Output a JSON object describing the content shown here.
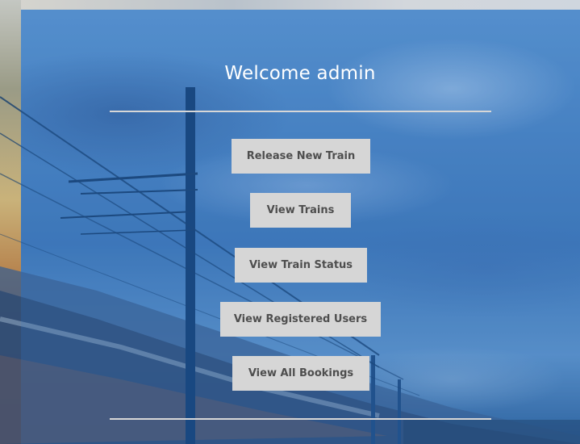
{
  "header": {
    "title": "Welcome admin"
  },
  "menu": {
    "buttons": [
      {
        "label": "Release New Train"
      },
      {
        "label": "View Trains"
      },
      {
        "label": "View Train Status"
      },
      {
        "label": "View Registered Users"
      },
      {
        "label": "View All Bookings"
      }
    ]
  },
  "colors": {
    "button_bg": "#d6d6d6",
    "button_text": "#4e4e4e",
    "title_text": "#ffffff",
    "rule": "#d7d7d7"
  }
}
